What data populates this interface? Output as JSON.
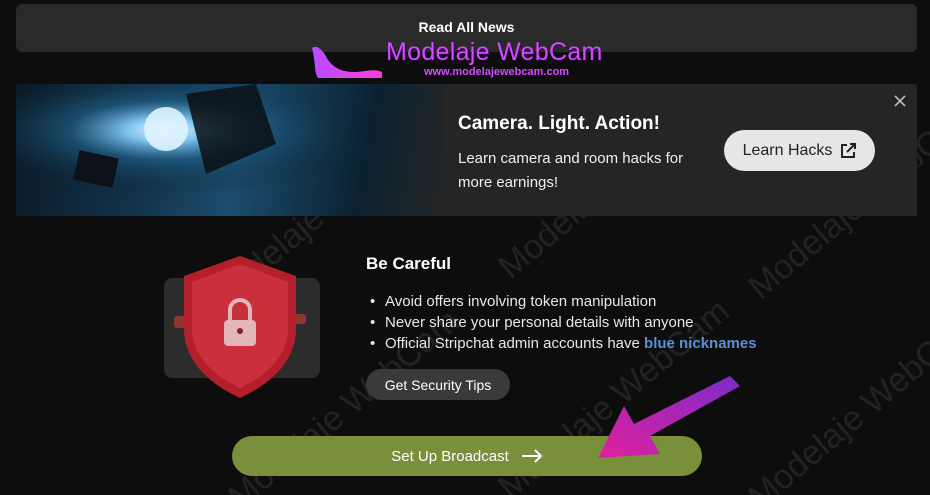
{
  "news_bar": {
    "label": "Read All News"
  },
  "watermark": {
    "brand": "Modelaje WebCam",
    "url": "www.modelajewebcam.com"
  },
  "promo": {
    "title": "Camera. Light. Action!",
    "description": "Learn camera and room hacks for more earnings!",
    "button_label": "Learn Hacks",
    "button_icon": "external-link-icon",
    "close_icon": "close-icon"
  },
  "safety": {
    "title": "Be Careful",
    "tips": [
      {
        "text": "Avoid offers involving token manipulation"
      },
      {
        "text": "Never share your personal details with anyone"
      },
      {
        "text": "Official Stripchat admin accounts have ",
        "highlight": "blue nicknames"
      }
    ],
    "button_label": "Get Security Tips"
  },
  "broadcast": {
    "label": "Set Up Broadcast",
    "icon": "arrow-right-icon"
  },
  "colors": {
    "accent_green": "#7a8f3c",
    "highlight_blue": "#5a8fd6",
    "brand_purple": "#d34cff"
  }
}
